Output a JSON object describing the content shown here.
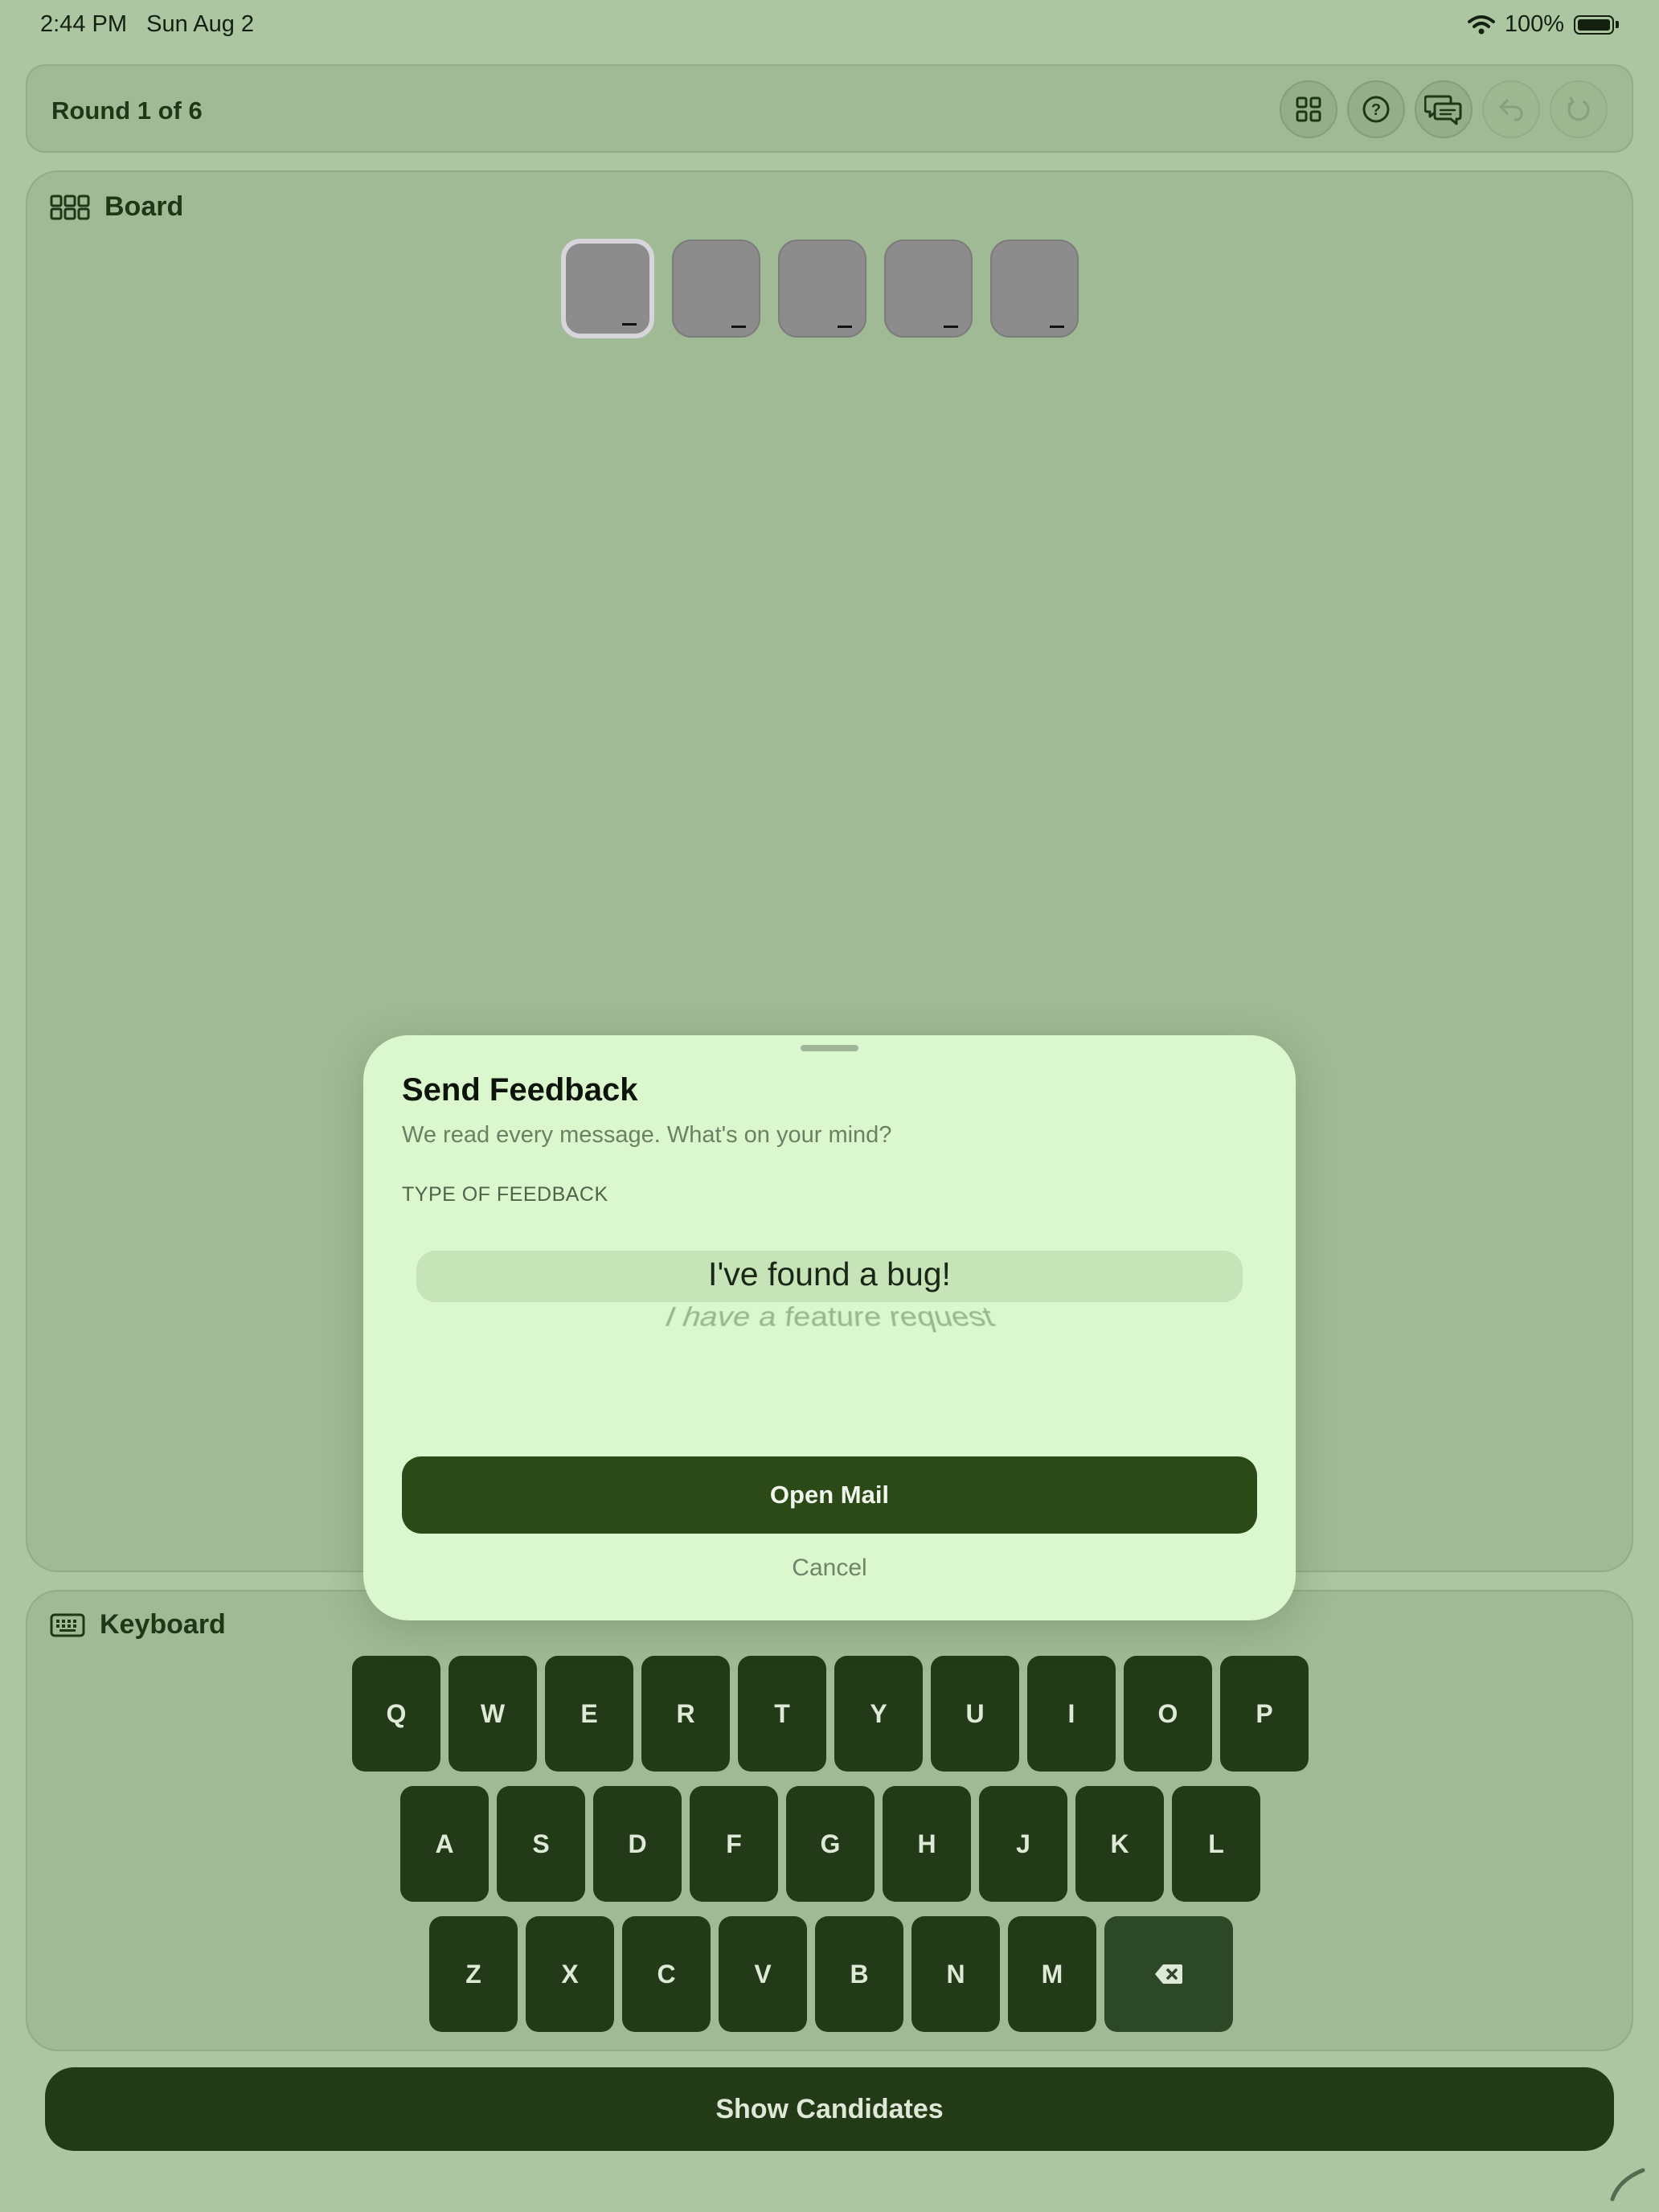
{
  "status_bar": {
    "time_date": "2:44 PM   Sun Aug 2",
    "battery": "100%"
  },
  "header": {
    "round": "Round 1 of 6",
    "toolbar_icons": [
      "grid-icon",
      "help-icon",
      "feedback-icon",
      "undo-icon",
      "redo-icon"
    ]
  },
  "board": {
    "title": "Board",
    "tiles": [
      "",
      "",
      "",
      "",
      ""
    ],
    "active_tile": 0
  },
  "keyboard": {
    "title": "Keyboard",
    "rows": [
      [
        "Q",
        "W",
        "E",
        "R",
        "T",
        "Y",
        "U",
        "I",
        "O",
        "P"
      ],
      [
        "A",
        "S",
        "D",
        "F",
        "G",
        "H",
        "J",
        "K",
        "L"
      ],
      [
        "Z",
        "X",
        "C",
        "V",
        "B",
        "N",
        "M"
      ]
    ],
    "backspace_icon": "backspace-icon"
  },
  "show_candidates": "Show Candidates",
  "feedback_sheet": {
    "title": "Send Feedback",
    "subtitle": "We read every message. What's on your mind?",
    "type_label": "TYPE OF FEEDBACK",
    "options": [
      "I've found a bug!",
      "I have a feature request"
    ],
    "selected_index": 0,
    "open_mail": "Open Mail",
    "cancel": "Cancel"
  },
  "colors": {
    "background": "#abc6a1",
    "card": "#a1ba96",
    "key": "#223a17",
    "sheet": "#dbf7cd",
    "primary_button": "#2b4a18"
  }
}
